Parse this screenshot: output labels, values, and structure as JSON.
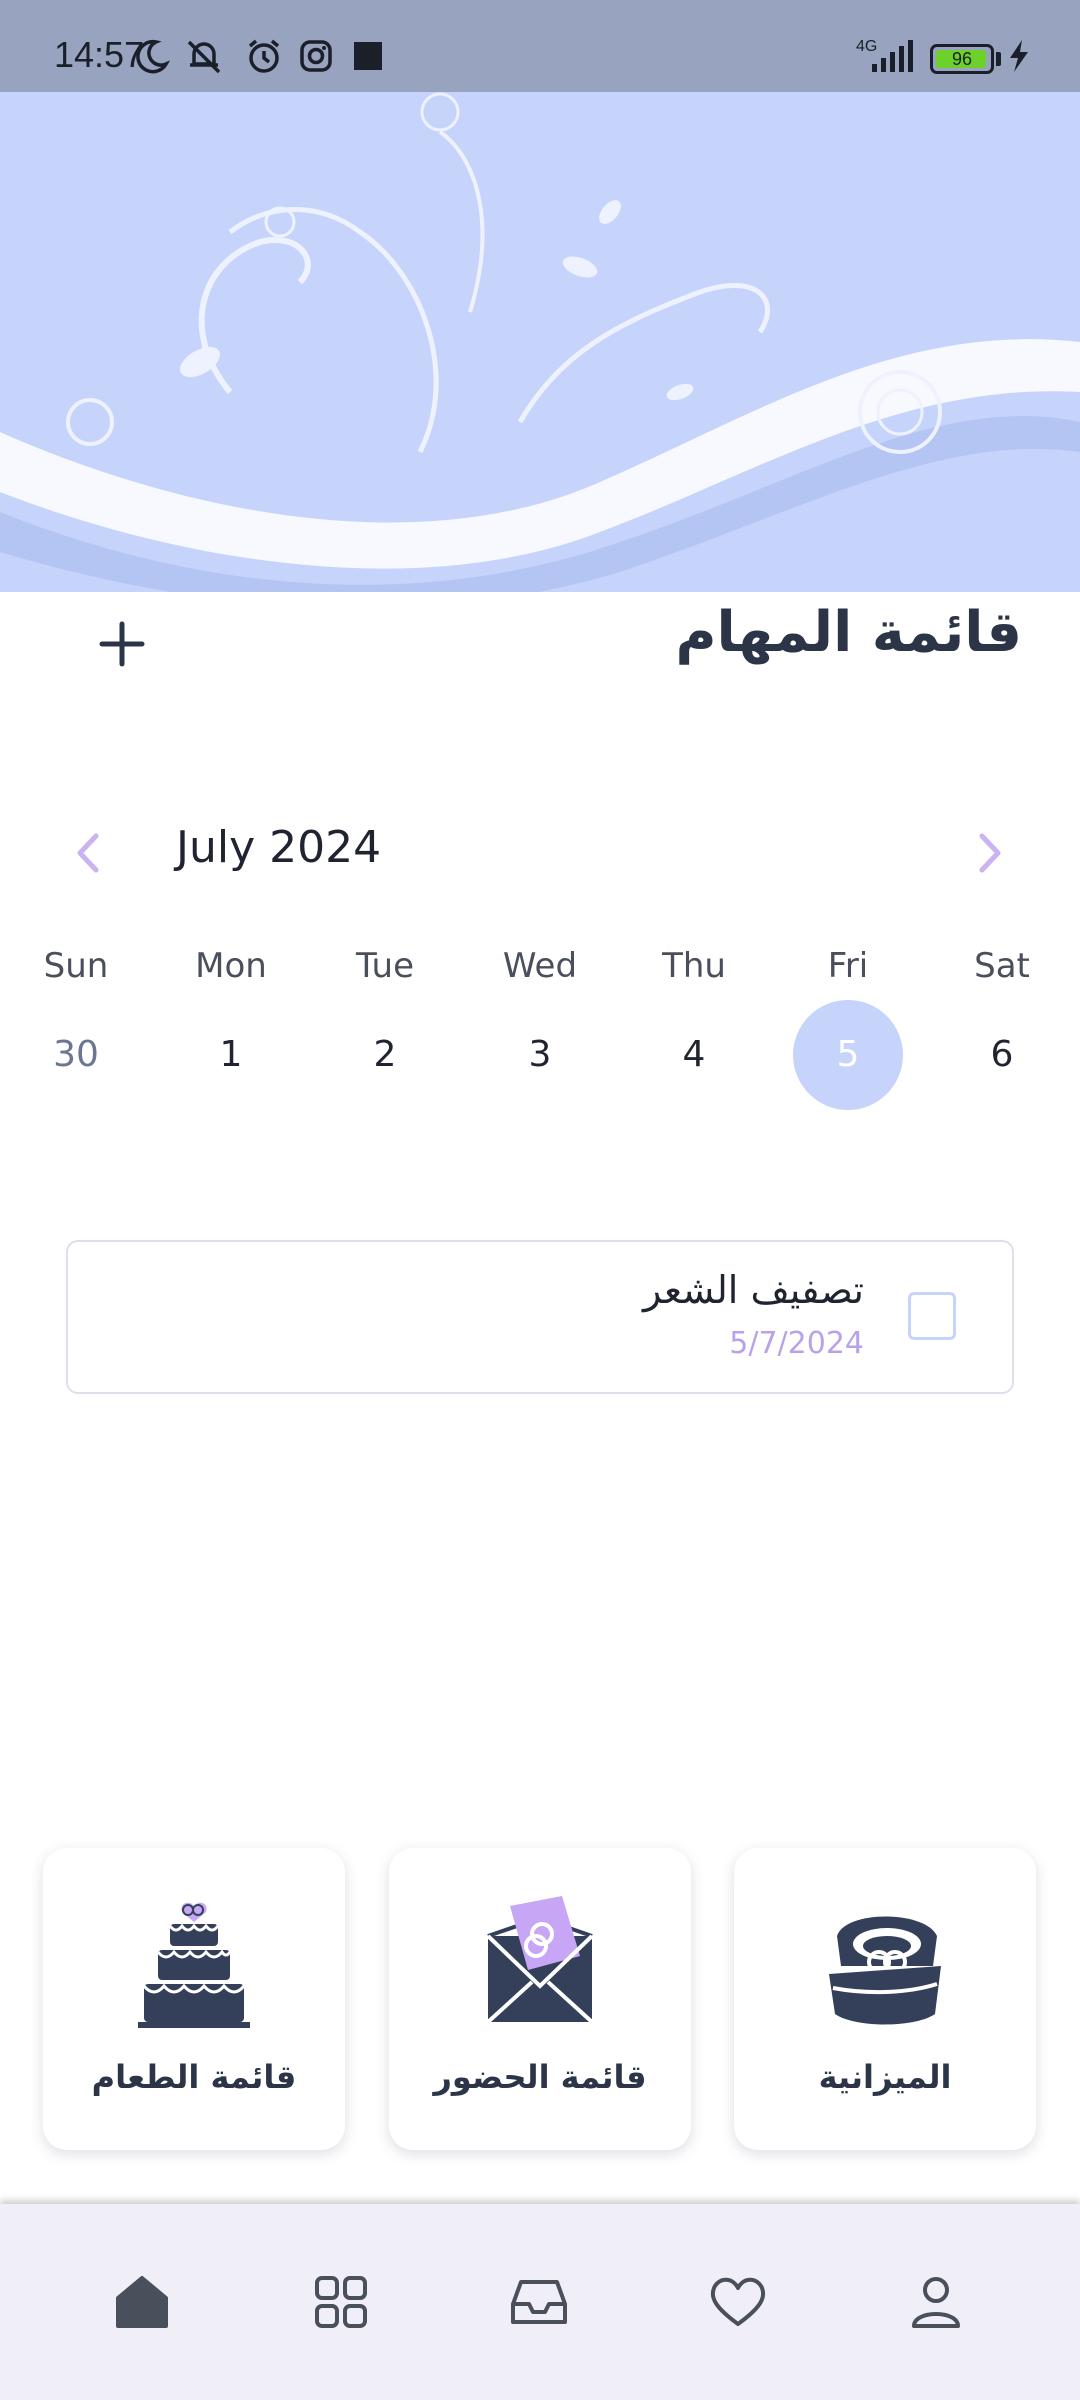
{
  "status_bar": {
    "time": "14:57",
    "network": "4G",
    "battery_percent": "96",
    "battery_level": 0.96,
    "icons": [
      "moon-icon",
      "mute-icon",
      "alarm-icon",
      "instagram-icon",
      "square-icon",
      "signal-icon",
      "battery-icon",
      "charging-icon"
    ]
  },
  "header": {
    "title": "قائمة المهام",
    "add_icon": "plus-icon"
  },
  "calendar": {
    "month_label": "July 2024",
    "weekdays": [
      "Sun",
      "Mon",
      "Tue",
      "Wed",
      "Thu",
      "Fri",
      "Sat"
    ],
    "days": [
      "30",
      "1",
      "2",
      "3",
      "4",
      "5",
      "6"
    ],
    "selected_day": "5",
    "accent_color": "#c6d4fb",
    "arrow_color": "#c9b3f2"
  },
  "tasks": [
    {
      "title": "تصفيف الشعر",
      "date": "5/7/2024",
      "checked": false
    }
  ],
  "quick_links": [
    {
      "label": "الميزانية",
      "icon": "ring-box-icon"
    },
    {
      "label": "قائمة الحضور",
      "icon": "invitation-envelope-icon"
    },
    {
      "label": "قائمة الطعام",
      "icon": "wedding-cake-icon"
    }
  ],
  "bottom_nav": [
    "home-icon",
    "grid-icon",
    "inbox-icon",
    "heart-icon",
    "profile-icon"
  ]
}
